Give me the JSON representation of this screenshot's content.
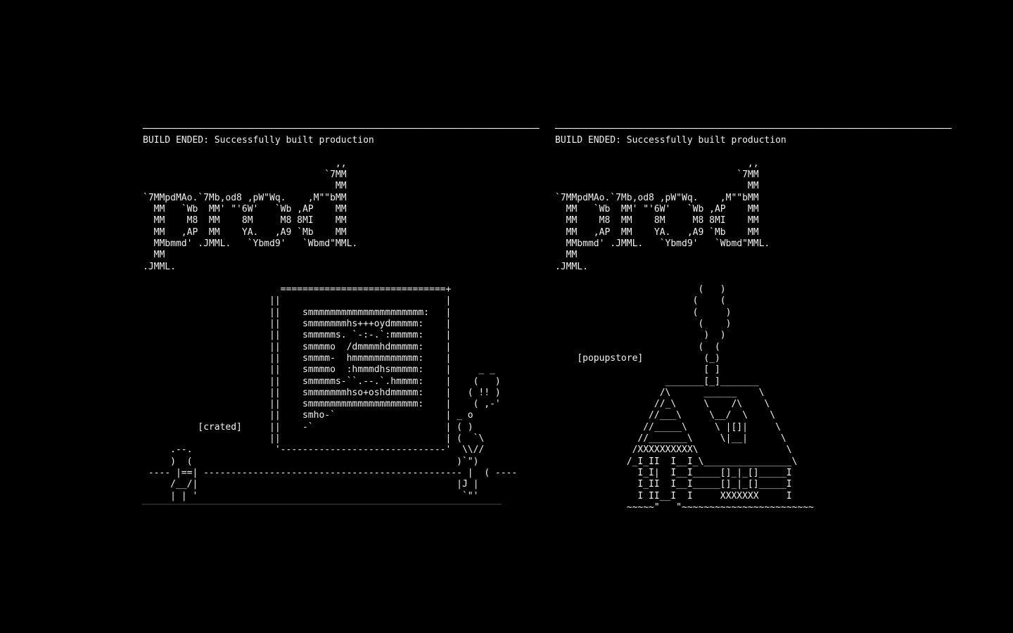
{
  "left_pane": {
    "text": "────────────────────────────────────────────────────────────────────────\nBUILD ENDED: Successfully built production\n\n                                   ,,\n                                 `7MM\n                                   MM\n`7MMpdMAo.`7Mb,od8 ,pW\"Wq.    ,M\"\"bMM\n  MM   `Wb  MM' \"'6W'   `Wb ,AP    MM\n  MM    M8  MM    8M     M8 8MI    MM\n  MM   ,AP  MM    YA.   ,A9 `Mb    MM\n  MMbmmd' .JMML.   `Ybmd9'   `Wbmd\"MML.\n  MM\n.JMML.\n\n                         ==============================+\n                       ||                              |\n                       ||    smmmmmmmmmmmmmmmmmmmmm:   |\n                       ||    smmmmmmmhs+++oydmmmmm:    |\n                       ||    smmmmms. `-:-.`:mmmmm:    |\n                       ||    smmmmo  /dmmmmhdmmmmm:    |\n                       ||    smmmm-  hmmmmmmmmmmmm:    |\n                       ||    smmmmo  :hmmmdhsmmmmm:    |     _ _\n                       ||    smmmmms-``.--.`.hmmmm:    |    (   )\n                       ||    smmmmmmmhso+oshdmmmmm:    |   ( !! )\n                       ||    smmmmmmmmmmmmmmmmmmmm:    |    ( ,-'\n                       ||    smho-`                    | _ o\n          [crated]     ||    -`                        | ( )\n                       ||                              | (  `\\\n     .--.               '------------------------------'  \\\\//\n     )  (                                                )`\")\n ---- |==| ----------------------------------------------- |  ( ----\n     /__/|                                               |J |\n     | | '                                                `\"'",
    "rule": ""
  },
  "right_pane": {
    "text": "────────────────────────────────────────────────────────────────────────\nBUILD ENDED: Successfully built production\n\n                                   ,,\n                                 `7MM\n                                   MM\n`7MMpdMAo.`7Mb,od8 ,pW\"Wq.    ,M\"\"bMM\n  MM   `Wb  MM' \"'6W'   `Wb ,AP    MM\n  MM    M8  MM    8M     M8 8MI    MM\n  MM   ,AP  MM    YA.   ,A9 `Mb    MM\n  MMbmmd' .JMML.   `Ybmd9'   `Wbmd\"MML.\n  MM\n.JMML.\n\n                          (   )\n                         (    (\n                         (     )\n                          (    )\n                           )  )\n                          (  (\n    [popupstore]           (_)\n                           [ ]\n                    _______[_]_______\n                   /\\      ______    \\\n                  //_\\     \\    /\\    \\\n                 //___\\     \\__/  \\    \\\n                //_____\\     \\ |[]|     \\\n               //_______\\     \\|__|      \\\n              /XXXXXXXXXX\\                \\\n             /_I_II  I__I_\\________________\\\n               I_I|  I__I_____[]_|_[]_____I\n               I_II  I__I_____[]_|_[]_____I\n               I II__I  I     XXXXXXX     I\n             ~~~~~\"   \"~~~~~~~~~~~~~~~~~~~~~~~~"
  },
  "colors": {
    "background": "#000000",
    "text": "#f2f2f2"
  }
}
